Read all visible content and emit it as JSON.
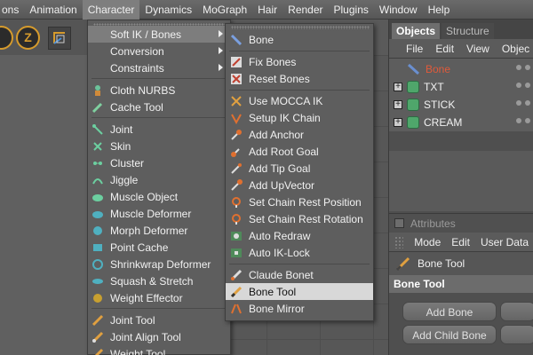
{
  "menubar": {
    "items": [
      "ons",
      "Animation",
      "Character",
      "Dynamics",
      "MoGraph",
      "Hair",
      "Render",
      "Plugins",
      "Window",
      "Help"
    ],
    "active": "Character"
  },
  "toolbar": {
    "z_label": "Z"
  },
  "character_menu": {
    "items": [
      {
        "label": "Soft IK / Bones",
        "submenu": true,
        "icon": "none"
      },
      {
        "label": "Conversion",
        "submenu": true,
        "icon": "none"
      },
      {
        "label": "Constraints",
        "submenu": true,
        "icon": "none"
      },
      {
        "label": "Cloth NURBS",
        "icon": "cloth-nurbs-icon"
      },
      {
        "label": "Cache Tool",
        "icon": "cache-tool-icon"
      },
      {
        "label": "Joint",
        "icon": "joint-icon"
      },
      {
        "label": "Skin",
        "icon": "skin-icon"
      },
      {
        "label": "Cluster",
        "icon": "cluster-icon"
      },
      {
        "label": "Jiggle",
        "icon": "jiggle-icon"
      },
      {
        "label": "Muscle Object",
        "icon": "muscle-object-icon"
      },
      {
        "label": "Muscle Deformer",
        "icon": "muscle-deformer-icon"
      },
      {
        "label": "Morph Deformer",
        "icon": "morph-deformer-icon"
      },
      {
        "label": "Point Cache",
        "icon": "point-cache-icon"
      },
      {
        "label": "Shrinkwrap Deformer",
        "icon": "shrinkwrap-icon"
      },
      {
        "label": "Squash & Stretch",
        "icon": "squash-stretch-icon"
      },
      {
        "label": "Weight Effector",
        "icon": "weight-effector-icon"
      },
      {
        "label": "Joint Tool",
        "icon": "joint-tool-icon"
      },
      {
        "label": "Joint Align Tool",
        "icon": "joint-align-icon"
      },
      {
        "label": "Weight Tool",
        "icon": "weight-tool-icon"
      }
    ]
  },
  "softik_menu": {
    "items": [
      {
        "label": "Bone",
        "icon": "bone-icon"
      },
      {
        "label": "Fix Bones",
        "icon": "fix-bones-icon"
      },
      {
        "label": "Reset Bones",
        "icon": "reset-bones-icon"
      },
      {
        "label": "Use MOCCA IK",
        "icon": "mocca-ik-icon"
      },
      {
        "label": "Setup IK Chain",
        "icon": "ik-chain-icon"
      },
      {
        "label": "Add Anchor",
        "icon": "anchor-icon"
      },
      {
        "label": "Add Root Goal",
        "icon": "root-goal-icon"
      },
      {
        "label": "Add Tip Goal",
        "icon": "tip-goal-icon"
      },
      {
        "label": "Add UpVector",
        "icon": "upvector-icon"
      },
      {
        "label": "Set Chain Rest Position",
        "icon": "rest-position-icon"
      },
      {
        "label": "Set Chain Rest Rotation",
        "icon": "rest-rotation-icon"
      },
      {
        "label": "Auto Redraw",
        "icon": "auto-redraw-icon"
      },
      {
        "label": "Auto IK-Lock",
        "icon": "ik-lock-icon"
      },
      {
        "label": "Claude Bonet",
        "icon": "claude-bonet-icon"
      },
      {
        "label": "Bone Tool",
        "icon": "bone-tool-icon",
        "selected": true
      },
      {
        "label": "Bone Mirror",
        "icon": "bone-mirror-icon"
      }
    ]
  },
  "objects_panel": {
    "tabs": [
      "Objects",
      "Structure"
    ],
    "menu": [
      "File",
      "Edit",
      "View",
      "Objec"
    ],
    "rows": [
      {
        "name": "Bone",
        "is_bone": true
      },
      {
        "name": "TXT"
      },
      {
        "name": "STICK"
      },
      {
        "name": "CREAM"
      }
    ]
  },
  "attributes_panel": {
    "title": "Attributes",
    "menu": [
      "Mode",
      "Edit",
      "User Data"
    ],
    "tool_label": "Bone Tool",
    "section": "Bone Tool",
    "buttons": [
      "Add Bone",
      "Add Child Bone"
    ]
  },
  "colors": {
    "accent_orange": "#d69b2c",
    "bone_red": "#e05a3a",
    "selection_light": "#d8d8d8"
  }
}
